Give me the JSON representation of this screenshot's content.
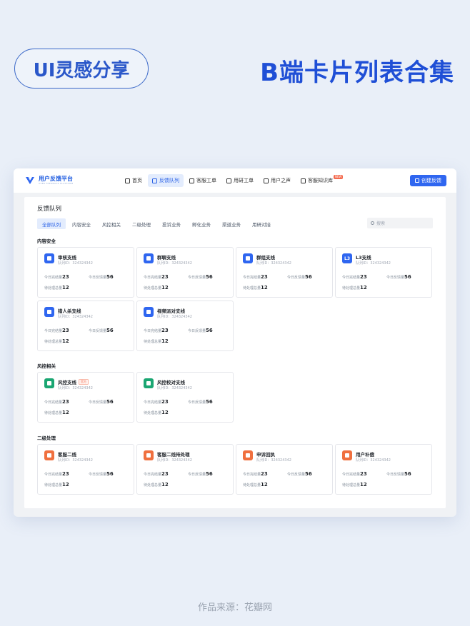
{
  "promo": {
    "pill": "UI灵感分享",
    "headline": "B端卡片列表合集",
    "source": "作品来源：花瓣网"
  },
  "app": {
    "logo_text": "用户反馈平台",
    "logo_sub": "USER FEEDBACK PLATFORM",
    "nav": [
      {
        "label": "首页",
        "icon": "home-icon",
        "active": false
      },
      {
        "label": "反馈队列",
        "icon": "queue-icon",
        "active": true
      },
      {
        "label": "客服工单",
        "icon": "ticket-icon",
        "active": false
      },
      {
        "label": "用研工单",
        "icon": "research-icon",
        "active": false
      },
      {
        "label": "用户之声",
        "icon": "voice-icon",
        "active": false
      },
      {
        "label": "客服知识库",
        "icon": "book-icon",
        "active": false,
        "badge": "NEW"
      }
    ],
    "create_label": "创建反馈"
  },
  "page": {
    "title": "反馈队列",
    "tabs": [
      "全部队列",
      "内容安全",
      "风控相关",
      "二级处理",
      "投诉业务",
      "孵化业务",
      "渠道业务",
      "用研对接"
    ],
    "active_tab": 0,
    "search_placeholder": "搜索"
  },
  "labels": {
    "queue_id": "队列ID：",
    "today_done": "今日完结量",
    "today_feedback": "今日反馈量",
    "pending": "待处理总量"
  },
  "sections": [
    {
      "title": "内容安全",
      "cards": [
        {
          "name": "审核支线",
          "id": "324324342",
          "done": "23",
          "feedback": "56",
          "pending": "12",
          "color": "#2f66f0",
          "icon": "user-icon"
        },
        {
          "name": "群聊支线",
          "id": "324324342",
          "done": "23",
          "feedback": "56",
          "pending": "12",
          "color": "#2f66f0",
          "icon": "chat-icon"
        },
        {
          "name": "群组支线",
          "id": "324324342",
          "done": "23",
          "feedback": "56",
          "pending": "12",
          "color": "#2f66f0",
          "icon": "group-icon"
        },
        {
          "name": "L3支线",
          "id": "324324342",
          "done": "23",
          "feedback": "56",
          "pending": "12",
          "color": "#2f66f0",
          "icon": "l3-icon",
          "icon_text": "L3"
        },
        {
          "name": "猎人杀支线",
          "id": "324324342",
          "done": "23",
          "feedback": "56",
          "pending": "12",
          "color": "#2f66f0",
          "icon": "game-icon"
        },
        {
          "name": "视频派对支线",
          "id": "324324342",
          "done": "23",
          "feedback": "56",
          "pending": "12",
          "color": "#2f66f0",
          "icon": "video-icon"
        }
      ]
    },
    {
      "title": "风控相关",
      "cards": [
        {
          "name": "风控支线",
          "id": "324324342",
          "done": "23",
          "feedback": "56",
          "pending": "12",
          "color": "#1aa672",
          "icon": "umbrella-icon",
          "tag": "官方"
        },
        {
          "name": "风控校对支线",
          "id": "324324342",
          "done": "23",
          "feedback": "56",
          "pending": "12",
          "color": "#1aa672",
          "icon": "umbrella-icon"
        }
      ]
    },
    {
      "title": "二级处理",
      "cards": [
        {
          "name": "客服二线",
          "id": "324324342",
          "done": "23",
          "feedback": "56",
          "pending": "12",
          "color": "#f0703f",
          "icon": "headset-icon"
        },
        {
          "name": "客服二线待处理",
          "id": "324324342",
          "done": "23",
          "feedback": "56",
          "pending": "12",
          "color": "#f0703f",
          "icon": "headset-icon"
        },
        {
          "name": "申诉回执",
          "id": "324324342",
          "done": "23",
          "feedback": "56",
          "pending": "12",
          "color": "#f0703f",
          "icon": "document-icon"
        },
        {
          "name": "用户补偿",
          "id": "324324342",
          "done": "23",
          "feedback": "56",
          "pending": "12",
          "color": "#f0703f",
          "icon": "gift-icon"
        }
      ]
    }
  ]
}
